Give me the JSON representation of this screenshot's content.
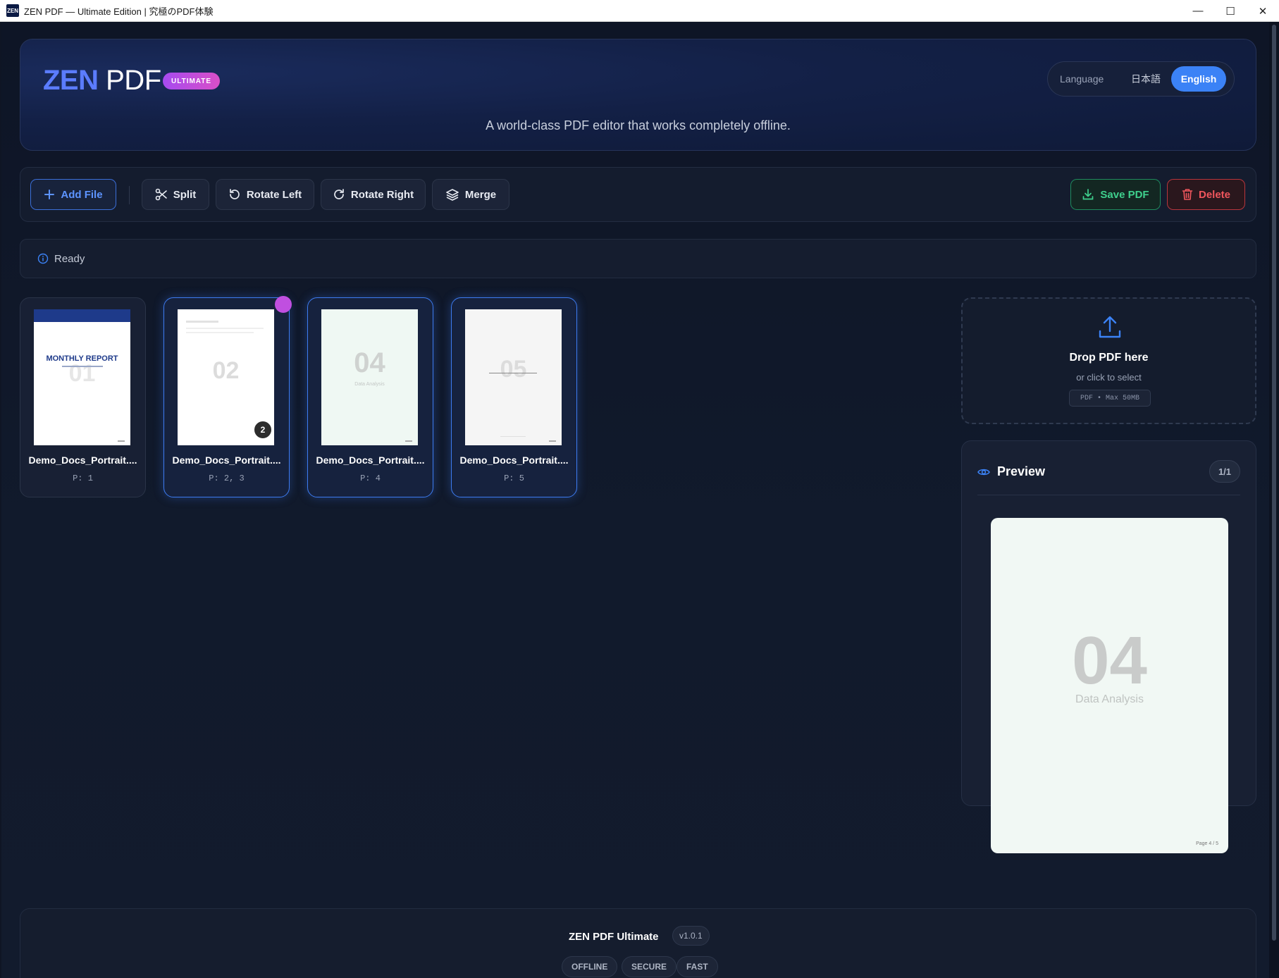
{
  "window": {
    "title": "ZEN PDF — Ultimate Edition | 究極のPDF体験",
    "app_icon_text": "ZEN",
    "minimize": "—",
    "maximize": "☐",
    "close": "✕"
  },
  "header": {
    "logo_zen": "ZEN",
    "logo_pdf": "PDF",
    "badge": "ULTIMATE",
    "tagline": "A world-class PDF editor that works completely offline.",
    "language": {
      "label": "Language",
      "options": [
        "日本語",
        "English"
      ],
      "selected": "English"
    }
  },
  "toolbar": {
    "add_file": "Add File",
    "split": "Split",
    "rotate_left": "Rotate Left",
    "rotate_right": "Rotate Right",
    "merge": "Merge",
    "save_pdf": "Save PDF",
    "delete": "Delete"
  },
  "status": {
    "text": "Ready"
  },
  "pages": [
    {
      "name": "Demo_Docs_Portrait....",
      "pages": "P: 1",
      "thumb_title": "MONTHLY REPORT",
      "thumb_num": "01"
    },
    {
      "name": "Demo_Docs_Portrait....",
      "pages": "P: 2, 3",
      "thumb_num": "02",
      "count": "2"
    },
    {
      "name": "Demo_Docs_Portrait....",
      "pages": "P: 4",
      "thumb_num": "04",
      "thumb_caption": "Data Analysis"
    },
    {
      "name": "Demo_Docs_Portrait....",
      "pages": "P: 5",
      "thumb_num": "05"
    }
  ],
  "dropzone": {
    "title": "Drop PDF here",
    "subtitle": "or click to select",
    "limits": "PDF • Max 50MB"
  },
  "preview": {
    "title": "Preview",
    "count": "1/1",
    "page_num": "04",
    "page_caption": "Data Analysis",
    "page_footer": "Page 4 / 5"
  },
  "footer": {
    "app_name": "ZEN PDF Ultimate",
    "version": "v1.0.1",
    "tags": [
      "OFFLINE",
      "SECURE",
      "FAST"
    ]
  },
  "colors": {
    "accent": "#3b82f6",
    "save": "#3fd08d",
    "delete": "#f0565d",
    "badge": "#c04fe0"
  }
}
